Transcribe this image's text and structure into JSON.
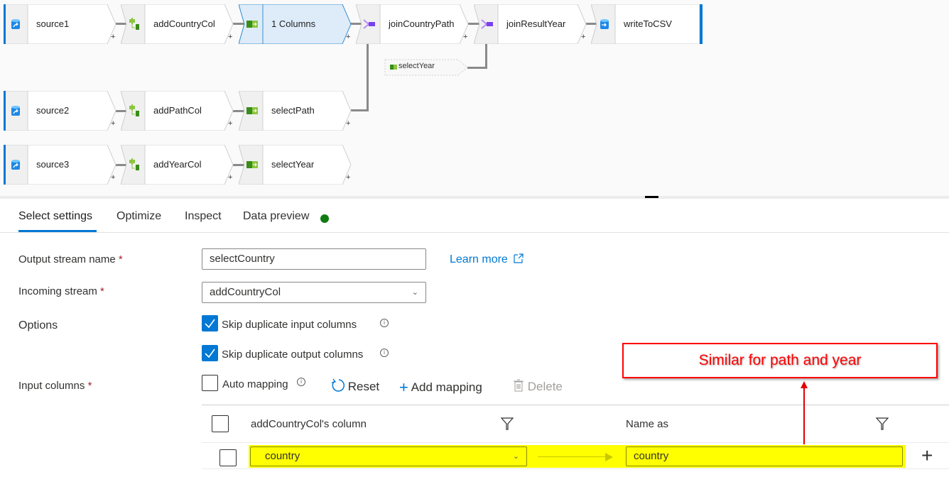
{
  "canvas": {
    "nodes": [
      {
        "id": "source1",
        "label": "source1",
        "type": "source",
        "icon": "database-source-icon"
      },
      {
        "id": "addCountryCol",
        "label": "addCountryCol",
        "type": "derived-column",
        "icon": "derived-column-icon"
      },
      {
        "id": "selectCountry",
        "label": "1 Columns",
        "type": "select",
        "icon": "select-icon",
        "selected": true
      },
      {
        "id": "joinCountryPath",
        "label": "joinCountryPath",
        "type": "join",
        "icon": "join-icon"
      },
      {
        "id": "joinResultYear",
        "label": "joinResultYear",
        "type": "join",
        "icon": "join-icon"
      },
      {
        "id": "writeToCSV",
        "label": "writeToCSV",
        "type": "sink",
        "icon": "database-sink-icon"
      },
      {
        "id": "source2",
        "label": "source2",
        "type": "source",
        "icon": "database-source-icon"
      },
      {
        "id": "addPathCol",
        "label": "addPathCol",
        "type": "derived-column",
        "icon": "derived-column-icon"
      },
      {
        "id": "selectPath",
        "label": "selectPath",
        "type": "select",
        "icon": "select-icon"
      },
      {
        "id": "source3",
        "label": "source3",
        "type": "source",
        "icon": "database-source-icon"
      },
      {
        "id": "addYearCol",
        "label": "addYearCol",
        "type": "derived-column",
        "icon": "derived-column-icon"
      },
      {
        "id": "selectYear",
        "label": "selectYear",
        "type": "select",
        "icon": "select-icon"
      }
    ],
    "reference_node": {
      "label": "selectYear",
      "icon": "select-icon"
    },
    "add_symbol": "+"
  },
  "tabs": [
    {
      "label": "Select settings",
      "active": true
    },
    {
      "label": "Optimize",
      "active": false
    },
    {
      "label": "Inspect",
      "active": false
    },
    {
      "label": "Data preview",
      "active": false,
      "status": "green-dot"
    }
  ],
  "form": {
    "output_stream_label": "Output stream name",
    "output_stream_value": "selectCountry",
    "incoming_stream_label": "Incoming stream",
    "incoming_stream_value": "addCountryCol",
    "required_marker": "*",
    "learn_more": "Learn more",
    "options_label": "Options",
    "options": [
      {
        "label": "Skip duplicate input columns",
        "checked": true
      },
      {
        "label": "Skip duplicate output columns",
        "checked": true
      }
    ],
    "input_columns_label": "Input columns",
    "auto_mapping_label": "Auto mapping",
    "auto_mapping_checked": false,
    "reset_label": "Reset",
    "add_mapping_label": "Add mapping",
    "delete_label": "Delete"
  },
  "mapping_grid": {
    "source_column_header": "addCountryCol's column",
    "name_as_header": "Name as",
    "rows": [
      {
        "source": "country",
        "name_as": "country",
        "highlighted": true
      }
    ]
  },
  "annotation": {
    "text": "Similar for path and year",
    "color": "#ff0000"
  },
  "colors": {
    "accent": "#0078d4",
    "status_green": "#107c10",
    "highlight": "#ffff00",
    "selected_node": "#deecf9"
  }
}
